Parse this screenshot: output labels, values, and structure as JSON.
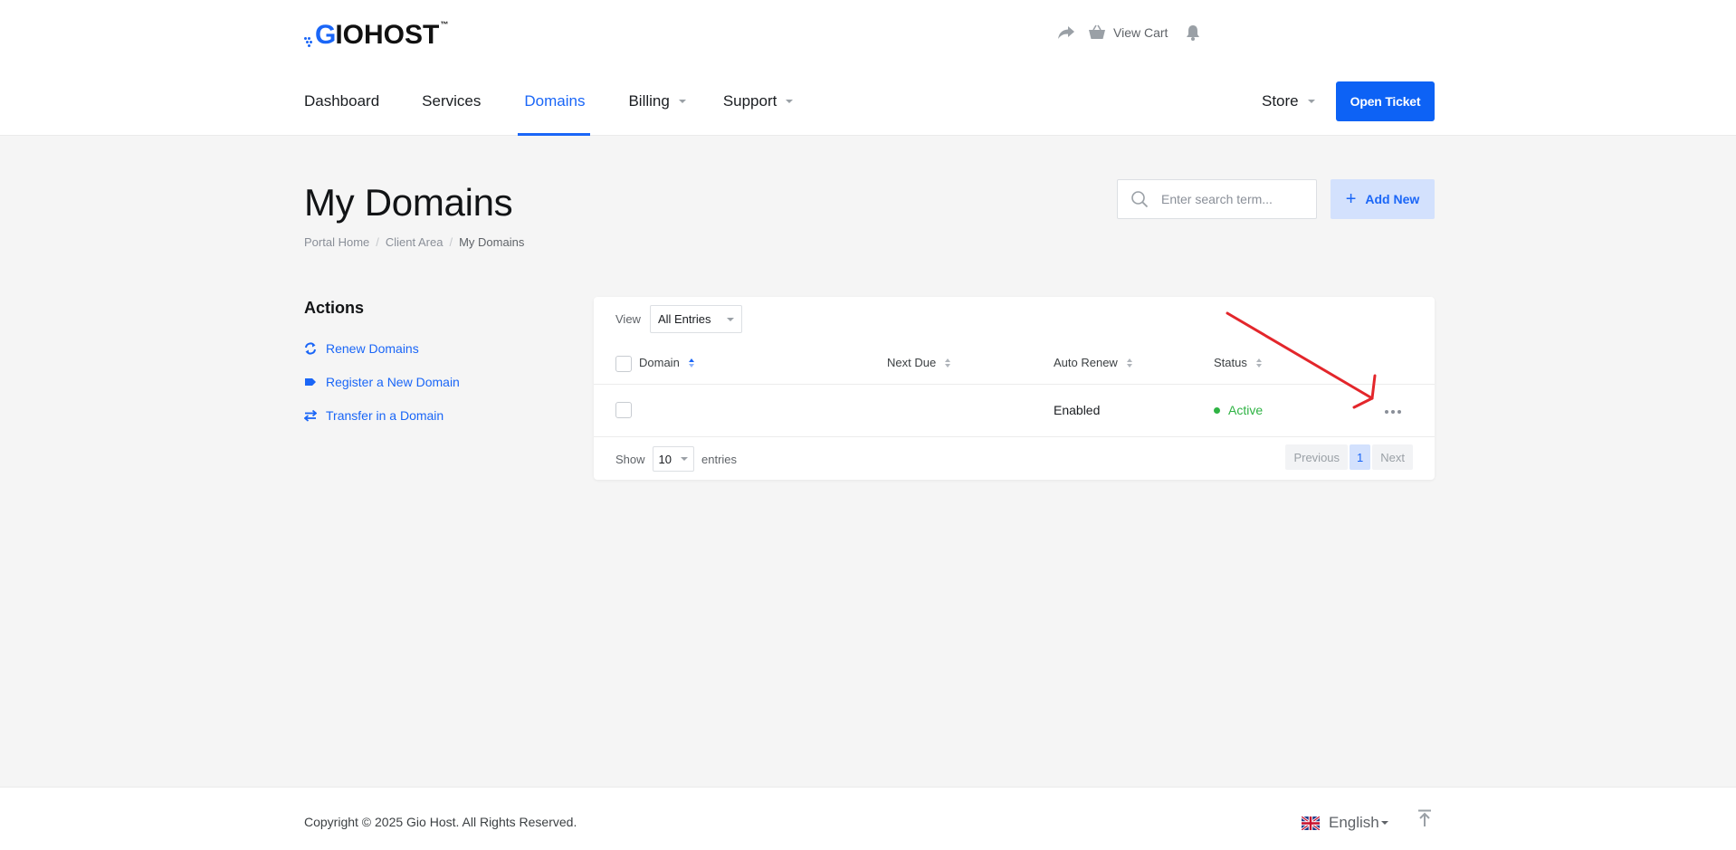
{
  "brand": {
    "logo_g": "G",
    "logo_rest": "IOHOST",
    "logo_tm": "™",
    "accent": "#1a66f7"
  },
  "top_tools": {
    "share_icon": "share-icon",
    "cart_label": "View Cart",
    "bell_icon": "bell-icon"
  },
  "nav": {
    "items": [
      {
        "label": "Dashboard"
      },
      {
        "label": "Services"
      },
      {
        "label": "Domains",
        "active": true
      },
      {
        "label": "Billing",
        "dropdown": true
      },
      {
        "label": "Support",
        "dropdown": true
      }
    ],
    "store_label": "Store",
    "open_ticket_label": "Open Ticket"
  },
  "page": {
    "title": "My Domains",
    "breadcrumb": [
      "Portal Home",
      "Client Area",
      "My Domains"
    ],
    "search_placeholder": "Enter search term...",
    "add_new_label": "Add New"
  },
  "sidebar": {
    "title": "Actions",
    "items": [
      {
        "label": "Renew Domains",
        "icon": "renew-icon"
      },
      {
        "label": "Register a New Domain",
        "icon": "tag-icon"
      },
      {
        "label": "Transfer in a Domain",
        "icon": "transfer-icon"
      }
    ]
  },
  "table": {
    "view_label": "View",
    "view_value": "All Entries",
    "columns": [
      "Domain",
      "Next Due",
      "Auto Renew",
      "Status"
    ],
    "rows": [
      {
        "domain": "",
        "next_due": "",
        "auto_renew": "Enabled",
        "status": "Active",
        "status_color": "#2fb344"
      }
    ],
    "show_label": "Show",
    "page_size": "10",
    "entries_label": "entries",
    "pager": {
      "previous": "Previous",
      "current": "1",
      "next": "Next"
    }
  },
  "footer": {
    "copyright": "Copyright © 2025 Gio Host. All Rights Reserved.",
    "language": "English"
  }
}
